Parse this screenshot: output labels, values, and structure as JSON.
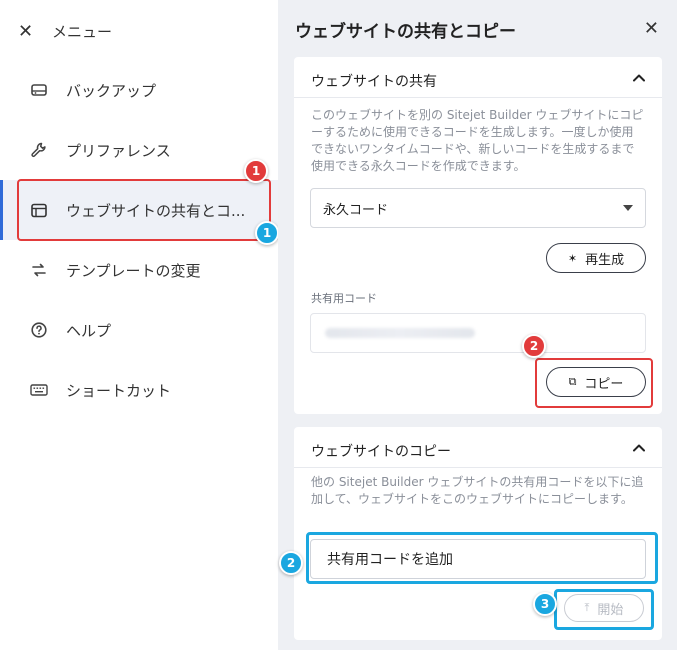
{
  "menu": {
    "title": "メニュー",
    "items": [
      {
        "label": "バックアップ",
        "icon": "drive-icon"
      },
      {
        "label": "プリファレンス",
        "icon": "wrench-icon"
      },
      {
        "label": "ウェブサイトの共有とコ...",
        "icon": "window-icon"
      },
      {
        "label": "テンプレートの変更",
        "icon": "swap-icon"
      },
      {
        "label": "ヘルプ",
        "icon": "help-icon"
      },
      {
        "label": "ショートカット",
        "icon": "keyboard-icon"
      }
    ]
  },
  "panel": {
    "title": "ウェブサイトの共有とコピー",
    "share": {
      "heading": "ウェブサイトの共有",
      "description": "このウェブサイトを別の Sitejet Builder ウェブサイトにコピーするために使用できるコードを生成します。一度しか使用できないワンタイムコードや、新しいコードを生成するまで使用できる永久コードを作成できます。",
      "select_value": "永久コード",
      "regenerate_label": "再生成",
      "code_label": "共有用コード",
      "copy_label": "コピー"
    },
    "copy": {
      "heading": "ウェブサイトのコピー",
      "description": "他の Sitejet Builder ウェブサイトの共有用コードを以下に追加して、ウェブサイトをこのウェブサイトにコピーします。",
      "input_placeholder": "共有用コードを追加",
      "start_label": "開始"
    }
  },
  "annotations": {
    "badges": [
      "1",
      "1",
      "2",
      "2",
      "3"
    ]
  },
  "colors": {
    "accent_red": "#e23b3b",
    "accent_blue": "#1aa7e0",
    "active_bar": "#2f6bd8"
  }
}
